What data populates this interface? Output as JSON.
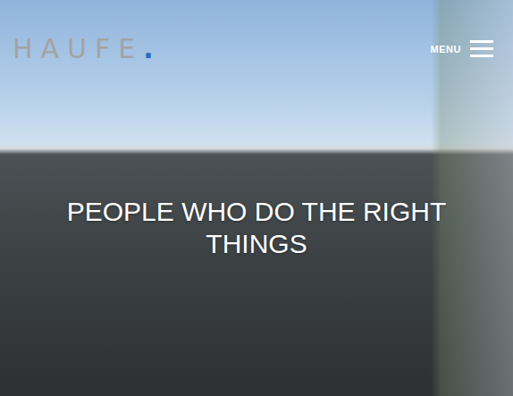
{
  "header": {
    "logo": {
      "text": "HAUFE",
      "mark": "."
    },
    "menu": {
      "label": "MENU"
    }
  },
  "hero": {
    "headline": "PEOPLE WHO DO THE RIGHT THINGS"
  }
}
